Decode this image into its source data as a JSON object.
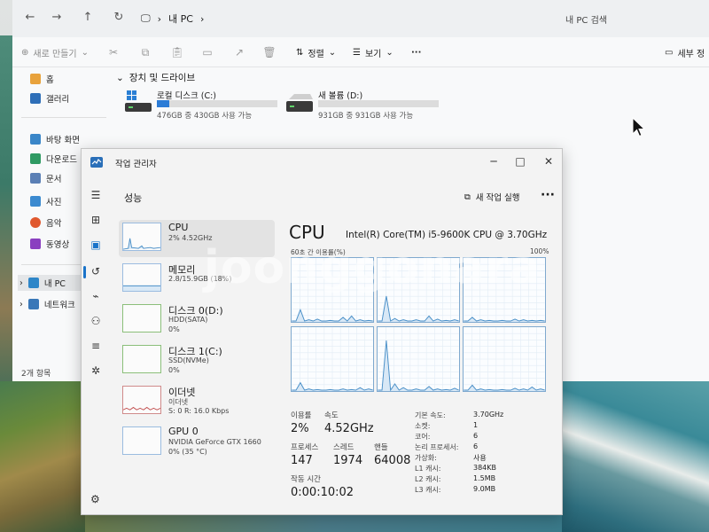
{
  "explorer": {
    "address": "내 PC",
    "search_placeholder": "내 PC 검색",
    "toolbar": {
      "new": "새로 만들기",
      "sort": "정렬",
      "view": "보기",
      "more": "···",
      "details": "세부 정"
    },
    "sidebar": {
      "items": [
        "홈",
        "갤러리",
        "바탕 화면",
        "다운로드",
        "문서",
        "사진",
        "음악",
        "동영상",
        "내 PC",
        "네트워크"
      ]
    },
    "drives_header": "장치 및 드라이브",
    "drives": [
      {
        "name": "로컬 디스크 (C:)",
        "free": "476GB 중 430GB 사용 가능",
        "used_fraction": 0.1
      },
      {
        "name": "새 볼륨 (D:)",
        "free": "931GB 중 931GB 사용 가능",
        "used_fraction": 0.0
      }
    ],
    "status": "2개 항목"
  },
  "taskmgr": {
    "title": "작업 관리자",
    "page_title": "성능",
    "new_task": "새 작업 실행",
    "more": "···",
    "resources": [
      {
        "name": "CPU",
        "sub": "2% 4.52GHz",
        "sub2": ""
      },
      {
        "name": "메모리",
        "sub": "2.8/15.9GB (18%)",
        "sub2": ""
      },
      {
        "name": "디스크 0(D:)",
        "sub": "HDD(SATA)",
        "sub2": "0%"
      },
      {
        "name": "디스크 1(C:)",
        "sub": "SSD(NVMe)",
        "sub2": "0%"
      },
      {
        "name": "이더넷",
        "sub": "이더넷",
        "sub2": "S: 0 R: 16.0 Kbps"
      },
      {
        "name": "GPU 0",
        "sub": "NVIDIA GeForce GTX 1660",
        "sub2": "0% (35 °C)"
      }
    ],
    "cpu": {
      "heading": "CPU",
      "model": "Intel(R) Core(TM) i5-9600K CPU @ 3.70GHz",
      "graph_label": "60초 간 이용률(%)",
      "graph_max": "100%",
      "stats": {
        "util_label": "이용률",
        "util": "2%",
        "speed_label": "속도",
        "speed": "4.52GHz",
        "proc_label": "프로세스",
        "proc": "147",
        "thread_label": "스레드",
        "thread": "1974",
        "handle_label": "핸들",
        "handle": "64008",
        "uptime_label": "작동 시간",
        "uptime": "0:00:10:02"
      },
      "specs": [
        {
          "label": "기본 속도:",
          "value": "3.70GHz"
        },
        {
          "label": "소켓:",
          "value": "1"
        },
        {
          "label": "코어:",
          "value": "6"
        },
        {
          "label": "논리 프로세서:",
          "value": "6"
        },
        {
          "label": "가상화:",
          "value": "사용"
        },
        {
          "label": "L1 캐시:",
          "value": "384KB"
        },
        {
          "label": "L2 캐시:",
          "value": "1.5MB"
        },
        {
          "label": "L3 캐시:",
          "value": "9.0MB"
        }
      ]
    }
  },
  "watermark": "joonggonara",
  "colors": {
    "accent": "#2c7cd6",
    "graph_line": "#4b90c8",
    "graph_fill": "#d8e8f6"
  }
}
